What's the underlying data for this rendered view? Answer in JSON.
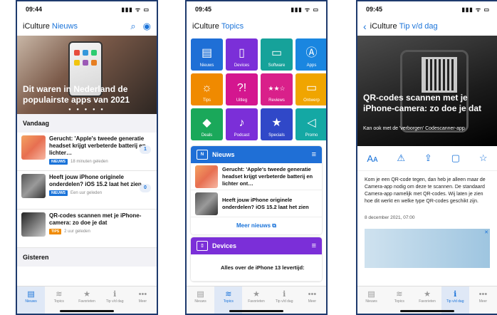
{
  "screen1": {
    "time": "09:44",
    "brand": "iCulture",
    "section": "Nieuws",
    "hero_title": "Dit waren in Nederland de populairste apps van 2021",
    "section_today": "Vandaag",
    "section_yesterday": "Gisteren",
    "items": [
      {
        "title": "Gerucht: 'Apple's tweede generatie headset krijgt verbeterde batterij en lichter…",
        "tag": "NIEUWS",
        "tag_color": "#1a73d9",
        "time": "18 minuten geleden",
        "count": "1"
      },
      {
        "title": "Heeft jouw iPhone originele onderdelen? iOS 15.2 laat het zien",
        "tag": "NIEUWS",
        "tag_color": "#1a73d9",
        "time": "Een uur geleden",
        "count": "0"
      },
      {
        "title": "QR-codes scannen met je iPhone-camera: zo doe je dat",
        "tag": "TIPS",
        "tag_color": "#f08a00",
        "time": "2 uur geleden",
        "count": ""
      }
    ]
  },
  "screen2": {
    "time": "09:45",
    "brand": "iCulture",
    "section": "Topics",
    "tiles": [
      {
        "label": "Nieuws",
        "color": "#1f6fd6",
        "glyph": "▤"
      },
      {
        "label": "Devices",
        "color": "#7b2fd8",
        "glyph": "▯"
      },
      {
        "label": "Software",
        "color": "#16a29a",
        "glyph": "▭"
      },
      {
        "label": "Apps",
        "color": "#1a86e0",
        "glyph": "Ⓐ"
      },
      {
        "label": "Tips",
        "color": "#f08a00",
        "glyph": "☼"
      },
      {
        "label": "Uitleg",
        "color": "#d4168f",
        "glyph": "?!"
      },
      {
        "label": "Reviews",
        "color": "#d9208a",
        "glyph": "★★☆"
      },
      {
        "label": "Ontwerp",
        "color": "#f0a500",
        "glyph": "▭"
      },
      {
        "label": "Deals",
        "color": "#1aa85a",
        "glyph": "◆"
      },
      {
        "label": "Podcast",
        "color": "#7b2fd8",
        "glyph": "♪"
      },
      {
        "label": "Specials",
        "color": "#3048c8",
        "glyph": "★"
      },
      {
        "label": "Promo",
        "color": "#14a8a4",
        "glyph": "◁"
      }
    ],
    "news_card": {
      "title": "Nieuws",
      "color": "#1f6fd6",
      "items": [
        "Gerucht: 'Apple's tweede generatie headset krijgt verbeterde batterij en lichter ont…",
        "Heeft jouw iPhone originele onderdelen? iOS 15.2 laat het zien"
      ],
      "more": "Meer nieuws ⧉"
    },
    "devices_card": {
      "title": "Devices",
      "color": "#7b2fd8",
      "item": "Alles over de iPhone 13 levertijd:"
    }
  },
  "screen3": {
    "time": "09:45",
    "back": "‹",
    "brand": "iCulture",
    "section": "Tip v/d dag",
    "hero_title": "QR-codes scannen met je iPhone-camera: zo doe je dat",
    "hero_sub": "Kan ook met de 'verborgen' Codescanner-app",
    "actions": [
      "Aᴀ",
      "⚠",
      "⇪",
      "▢",
      "☆"
    ],
    "body": "Kom je een QR-code tegen, dan heb je alleen maar de Camera-app nodig om deze te scannen. De standaard Camera-app namelijk met QR-codes. Wij laten je zien hoe dit werkt en welke type QR-codes geschikt zijn.",
    "date": "8 december 2021, 07:00",
    "ad_close": "✕"
  },
  "tabs": [
    {
      "label": "Nieuws",
      "glyph": "▤"
    },
    {
      "label": "Topics",
      "glyph": "≋"
    },
    {
      "label": "Favorieten",
      "glyph": "★"
    },
    {
      "label": "Tip v/d dag",
      "glyph": "ℹ"
    },
    {
      "label": "Meer",
      "glyph": "•••"
    }
  ],
  "status_icons": "▮▮▮ ᯤ ▭"
}
